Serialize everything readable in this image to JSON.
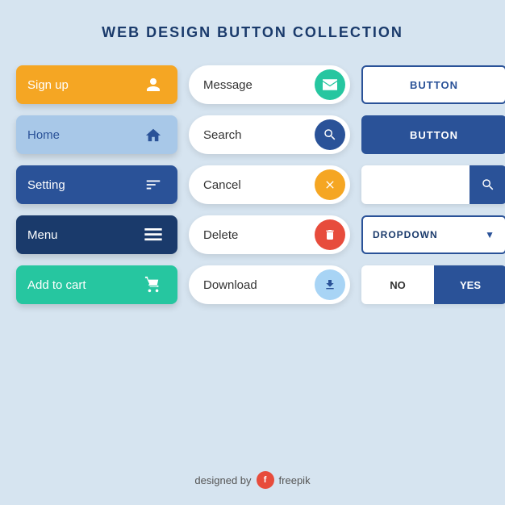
{
  "title": "WEB DESIGN BUTTON COLLECTION",
  "col1": {
    "buttons": [
      {
        "label": "Sign up",
        "icon": "👤",
        "class": "btn-orange",
        "name": "sign-up-button"
      },
      {
        "label": "Home",
        "icon": "⌂",
        "class": "btn-lightblue",
        "name": "home-button"
      },
      {
        "label": "Setting",
        "icon": "⚙",
        "class": "btn-darkblue",
        "name": "setting-button"
      },
      {
        "label": "Menu",
        "icon": "≡",
        "class": "btn-navy",
        "name": "menu-button"
      },
      {
        "label": "Add to cart",
        "icon": "🛒",
        "class": "btn-teal",
        "name": "add-to-cart-button"
      }
    ]
  },
  "col2": {
    "buttons": [
      {
        "label": "Message",
        "icon": "✉",
        "pillClass": "pill-teal",
        "name": "message-button"
      },
      {
        "label": "Search",
        "icon": "🔍",
        "pillClass": "pill-blue",
        "name": "search-button"
      },
      {
        "label": "Cancel",
        "icon": "✕",
        "pillClass": "pill-orange",
        "name": "cancel-button"
      },
      {
        "label": "Delete",
        "icon": "🗑",
        "pillClass": "pill-red",
        "name": "delete-button"
      },
      {
        "label": "Download",
        "icon": "⬇",
        "pillClass": "pill-lightblue",
        "name": "download-button"
      }
    ]
  },
  "col3": {
    "button1_label": "BUTTON",
    "button2_label": "BUTTON",
    "dropdown_label": "DROPDOWN",
    "no_label": "NO",
    "yes_label": "YES"
  },
  "footer": {
    "text": "designed by",
    "brand": "freepik"
  }
}
